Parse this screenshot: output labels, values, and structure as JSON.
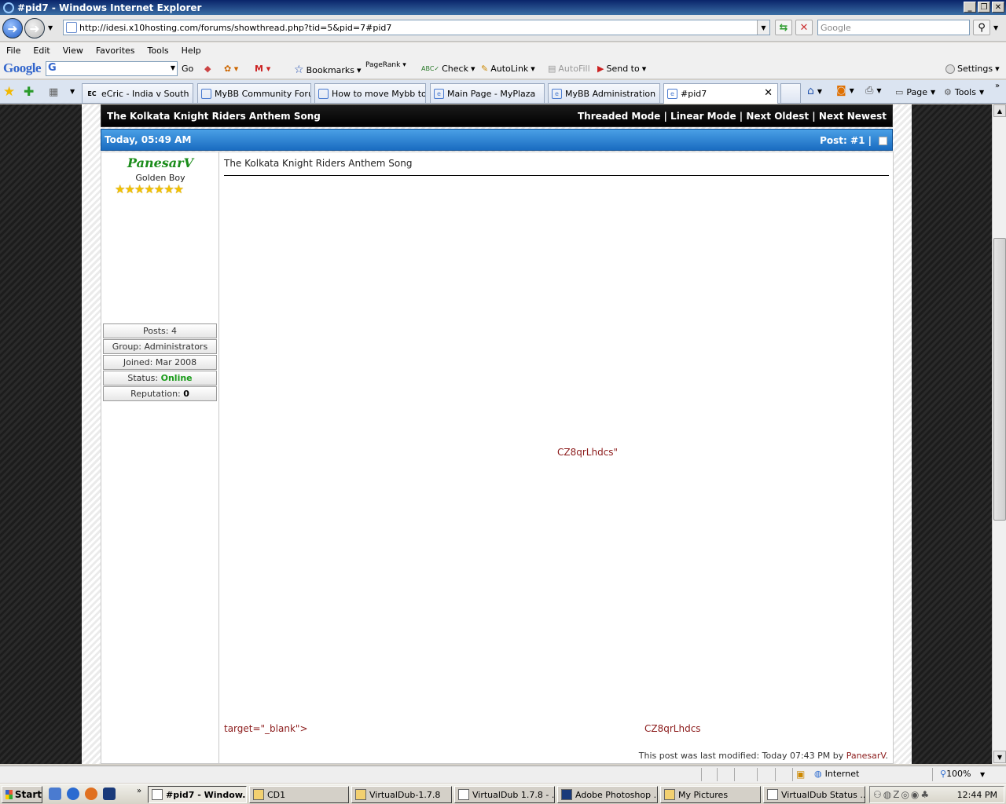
{
  "window": {
    "title": "#pid7 - Windows Internet Explorer",
    "buttons": [
      "_",
      "❐",
      "✕"
    ]
  },
  "address": {
    "url": "http://idesi.x10hosting.com/forums/showthread.php?tid=5&pid=7#pid7",
    "search_placeholder": "Google"
  },
  "menu": [
    "File",
    "Edit",
    "View",
    "Favorites",
    "Tools",
    "Help"
  ],
  "google_toolbar": {
    "logo": "Google",
    "go": "Go",
    "bookmarks": "Bookmarks",
    "pagerank": "PageRank",
    "check": "Check",
    "autolink": "AutoLink",
    "autofill": "AutoFill",
    "sendto": "Send to",
    "settings": "Settings"
  },
  "tabs": [
    {
      "label": "eCric - India v South ...",
      "icon": "EC"
    },
    {
      "label": "MyBB Community Foru...",
      "icon": ""
    },
    {
      "label": "How to move Mybb to...",
      "icon": ""
    },
    {
      "label": "Main Page - MyPlaza",
      "icon": "e"
    },
    {
      "label": "MyBB Administration",
      "icon": "e"
    },
    {
      "label": "#pid7",
      "icon": "e"
    }
  ],
  "command_bar": {
    "page": "Page",
    "tools": "Tools"
  },
  "thread": {
    "title": "The Kolkata Knight Riders Anthem Song",
    "links": {
      "threaded": "Threaded Mode",
      "linear": "Linear Mode",
      "next_oldest": "Next Oldest",
      "next_newest": "Next Newest",
      "sep": " | "
    }
  },
  "post": {
    "date": "Today, 05:49 AM",
    "post_number": "Post: #1",
    "post_sep": " |",
    "author": {
      "name": "PanesarV",
      "title": "Golden Boy",
      "stars": "★★★★★★★",
      "posts": "Posts: 4",
      "group": "Group: Administrators",
      "joined": "Joined: Mar 2008",
      "status_label": "Status: ",
      "status_value": "Online",
      "reputation_label": "Reputation: ",
      "reputation_value": "0"
    },
    "subject": "The Kolkata Knight Riders Anthem Song",
    "body_text1": "CZ8qrLhdcs\"",
    "body_text2": "target=\"_blank\">",
    "body_text3": "CZ8qrLhdcs",
    "modified_prefix": "This post was last modified: Today 07:43 PM by ",
    "modified_user": "PanesarV",
    "modified_suffix": "."
  },
  "statusbar": {
    "zone": "Internet",
    "zoom": "100%"
  },
  "taskbar": {
    "start": "Start",
    "tasks": [
      {
        "label": "#pid7 - Window...",
        "active": true
      },
      {
        "label": "CD1"
      },
      {
        "label": "VirtualDub-1.7.8"
      },
      {
        "label": "VirtualDub 1.7.8 - ..."
      },
      {
        "label": "Adobe Photoshop ..."
      },
      {
        "label": "My Pictures"
      },
      {
        "label": "VirtualDub Status ..."
      }
    ],
    "clock": "12:44 PM"
  }
}
